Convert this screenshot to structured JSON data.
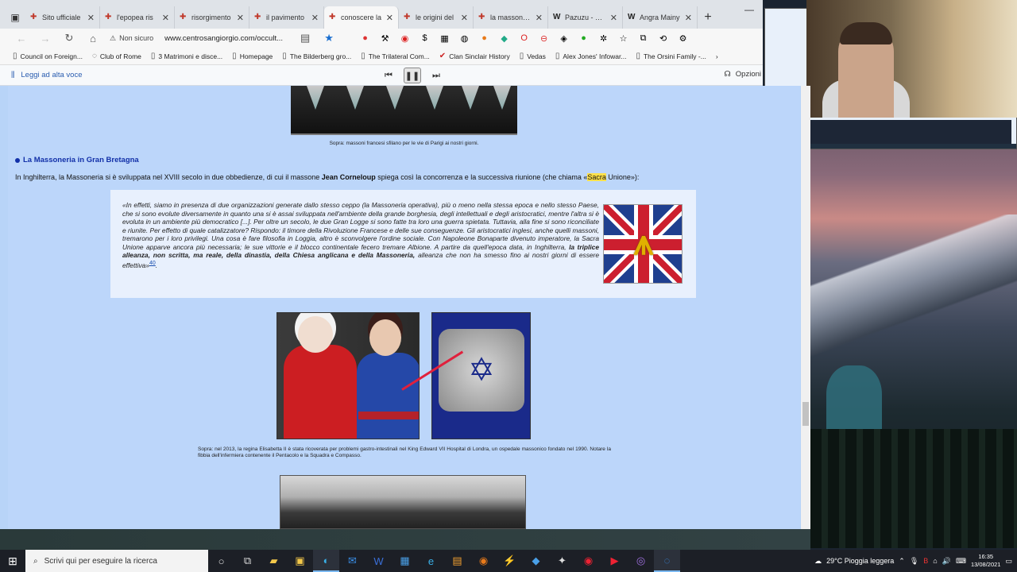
{
  "browser": {
    "tabs": [
      {
        "label": "Sito ufficiale"
      },
      {
        "label": "l'epopea ris"
      },
      {
        "label": "risorgimento"
      },
      {
        "label": "il pavimento"
      },
      {
        "label": "conoscere la"
      },
      {
        "label": "le origini del"
      },
      {
        "label": "la massoneria"
      },
      {
        "label": "Pazuzu - Wiki"
      },
      {
        "label": "Angra Mainy"
      }
    ],
    "active_tab": 4,
    "security": "Non sicuro",
    "url": "www.centrosangiorgio.com/occult...",
    "bookmarks": [
      "Council on Foreign...",
      "Club of Rome",
      "3 Matrimoni e disce...",
      "Homepage",
      "The Bilderberg gro...",
      "The Trilateral Com...",
      "Clan Sinclair History",
      "Vedas",
      "Alex Jones' Infowar...",
      "The Orsini Family -..."
    ],
    "read_aloud_label": "Leggi ad alta voce",
    "options_label": "Opzioni"
  },
  "article": {
    "caption_top": "Sopra: massoni francesi sfilano per le vie di Parigi ai nostri giorni.",
    "section_title": "La Massoneria in Gran Bretagna",
    "intro_before": "In Inghilterra, la Massoneria si è sviluppata nel XVIII secolo in due obbedienze, di cui il massone ",
    "intro_author": "Jean Corneloup",
    "intro_middle": " spiega così la concorrenza e la successiva riunione (che chiama «",
    "intro_highlight": "Sacra",
    "intro_after": " Unione»):",
    "quote_main": "«In effetti, siamo in presenza di due organizzazioni generate dallo stesso ceppo (la Massoneria operativa), più o meno nella stessa epoca e nello stesso Paese, che si sono evolute diversamente in quanto una si è assai sviluppata nell'ambiente della grande borghesia, degli intellettuali e degli aristocratici, mentre l'altra si è evoluta in un ambiente più democratico [...]. Per oltre un secolo, le due Gran Logge si sono fatte tra loro una guerra spietata. Tuttavia, alla fine si sono riconciliate e riunite. Per effetto di quale catalizzatore? Rispondo: il timore della Rivoluzione Francese e delle sue conseguenze. Gli aristocratici inglesi, anche quelli massoni, tremarono per i loro privilegi. Una cosa è fare filosofia in Loggia, altro è sconvolgere l'ordine sociale. Con Napoleone Bonaparte divenuto imperatore, la Sacra Unione apparve ancora più necessaria; le sue vittorie e il blocco continentale fecero tremare Albione. A partire da quell'epoca data, in Inghilterra, ",
    "quote_bold": "la triplice alleanza, non scritta, ma reale, della dinastia, della Chiesa anglicana e della Massoneria,",
    "quote_end": " alleanza che non ha smesso fino ai nostri giorni di essere effettiva»",
    "quote_ref": "40",
    "quote_period": ".",
    "caption_mid": "Sopra: nel 2013, la regina Elisabetta II è stata ricoverata per problemi gastro-intestinali nel King Edward VII Hospital di Londra, un ospedale massonico fondato nel 1990. Notare la fibbia dell'infermiera contenente il Pentacolo e la Squadra e Compasso."
  },
  "taskbar": {
    "search_placeholder": "Scrivi qui per eseguire la ricerca",
    "weather": "29°C  Pioggia leggera",
    "time": "16:35",
    "date": "13/08/2021"
  }
}
